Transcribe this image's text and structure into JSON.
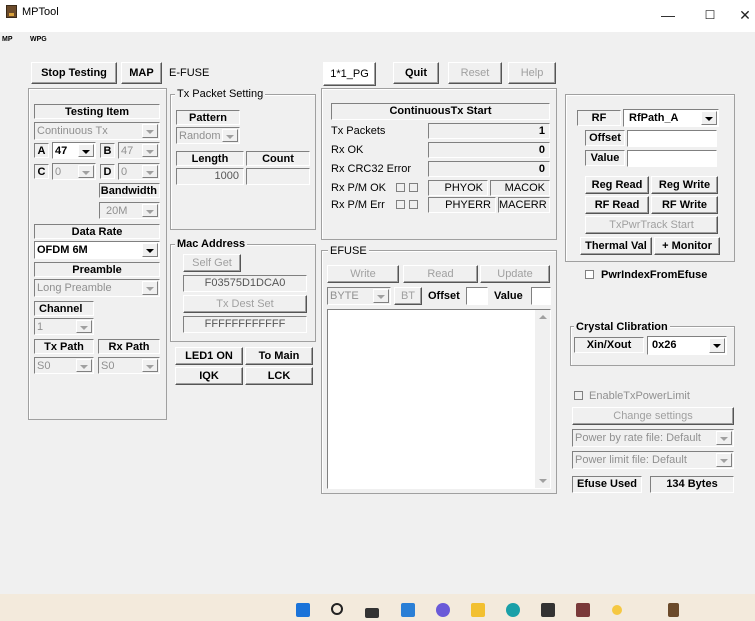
{
  "window": {
    "title": "MPTool",
    "minimize": "—",
    "maximize": "☐",
    "close": "✕"
  },
  "menu": [
    "MP",
    "WPG"
  ],
  "top_tabs": [
    {
      "label": "Stop Testing"
    },
    {
      "label": "MAP"
    },
    {
      "label": "E-FUSE"
    },
    {
      "label": "1*1_PG"
    },
    {
      "label": "Quit"
    },
    {
      "label": "Reset"
    },
    {
      "label": "Help"
    }
  ],
  "testing_item": {
    "header": "Testing Item",
    "mode": "Continuous Tx",
    "a_label": "A",
    "a_value": "47",
    "b_label": "B",
    "b_value": "47",
    "c_label": "C",
    "c_value": "0",
    "d_label": "D",
    "d_value": "0",
    "bandwidth_label": "Bandwidth",
    "bandwidth_value": "20M",
    "data_rate_label": "Data Rate",
    "data_rate_value": "OFDM 6M",
    "preamble_label": "Preamble",
    "preamble_value": "Long Preamble",
    "channel_label": "Channel",
    "channel_value": "1",
    "tx_path_label": "Tx Path",
    "tx_path_value": "S0",
    "rx_path_label": "Rx Path",
    "rx_path_value": "S0"
  },
  "tx_packet": {
    "title": "Tx Packet Setting",
    "pattern_label": "Pattern",
    "pattern_value": "Random",
    "length_label": "Length",
    "count_label": "Count",
    "length_value": "1000",
    "count_value": ""
  },
  "mac": {
    "title": "Mac Address",
    "self_get": "Self Get",
    "address": "F03575D1DCA0",
    "dest_set": "Tx Dest Set",
    "dest": "FFFFFFFFFFFF"
  },
  "bottom_buttons": {
    "led": "LED1 ON",
    "to_main": "To Main",
    "iqk": "IQK",
    "lck": "LCK"
  },
  "cont_tx": {
    "start": "ContinuousTx Start",
    "rows": [
      {
        "label": "Tx Packets",
        "value": "1"
      },
      {
        "label": "Rx OK",
        "value": "0"
      },
      {
        "label": "Rx CRC32 Error",
        "value": "0"
      }
    ],
    "pm_ok": "Rx P/M OK",
    "phyok": "PHYOK",
    "macok": "MACOK",
    "pm_err": "Rx P/M Err",
    "phyerr": "PHYERR",
    "macerr": "MACERR"
  },
  "efuse": {
    "title": "EFUSE",
    "write": "Write",
    "read": "Read",
    "update": "Update",
    "mode": "BYTE",
    "bt": "BT",
    "offset_label": "Offset",
    "value_label": "Value"
  },
  "rf": {
    "rf_label": "RF",
    "rf_path": "RfPath_A",
    "offset_label": "Offset",
    "value_label": "Value",
    "reg_read": "Reg Read",
    "reg_write": "Reg Write",
    "rf_read": "RF Read",
    "rf_write": "RF Write",
    "track": "TxPwrTrack Start",
    "thermal": "Thermal Val",
    "monitor": "+ Monitor"
  },
  "pwr_index": "PwrIndexFromEfuse",
  "crystal": {
    "title": "Crystal Clibration",
    "label": "Xin/Xout",
    "value": "0x26"
  },
  "power": {
    "enable_limit": "EnableTxPowerLimit",
    "change": "Change settings",
    "by_rate": "Power by rate file: Default",
    "limit": "Power limit file: Default",
    "efuse_used_label": "Efuse Used",
    "efuse_used_value": "134 Bytes"
  },
  "taskbar_icons": [
    "windows-icon",
    "search-icon",
    "taskview-icon",
    "widgets-icon",
    "chat-icon",
    "explorer-icon",
    "edge-icon",
    "store-icon",
    "app-icon",
    "sun-icon",
    "mptool-icon"
  ]
}
